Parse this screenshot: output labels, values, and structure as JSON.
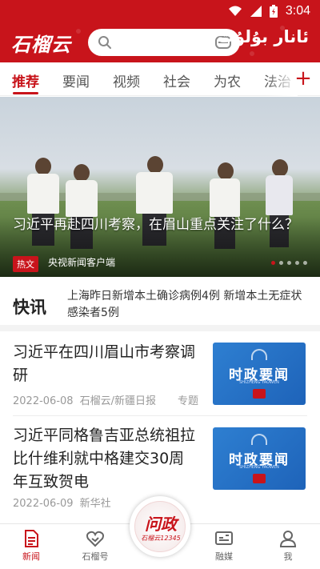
{
  "status_bar": {
    "time": "3:04",
    "icons": [
      "wifi-icon",
      "signal-icon",
      "battery-icon"
    ]
  },
  "header": {
    "logo_text": "石榴云",
    "uyghur_text": "ئانار بۇلۇت",
    "brand_color": "#c8141b"
  },
  "tabs": [
    {
      "label": "推荐",
      "active": true
    },
    {
      "label": "要闻"
    },
    {
      "label": "视频"
    },
    {
      "label": "社会"
    },
    {
      "label": "为农"
    },
    {
      "label": "法治"
    }
  ],
  "tab_add_label": "+",
  "hero": {
    "title": "习近平再赴四川考察，在眉山重点关注了什么？",
    "badge": "热文",
    "source": "央视新闻客户端",
    "slide_count": 5,
    "active_slide": 1
  },
  "flash": {
    "title": "快讯",
    "text": "上海昨日新增本土确诊病例4例 新增本土无症状感染者5例"
  },
  "news": [
    {
      "title": "习近平在四川眉山市考察调研",
      "date": "2022-06-08",
      "source": "石榴云/新疆日报",
      "tag": "专题",
      "thumb_text": "时政要闻",
      "thumb_sub": "SHIZHENG YAOWEN"
    },
    {
      "title": "习近平同格鲁吉亚总统祖拉比什维利就中格建交30周年互致贺电",
      "date": "2022-06-09",
      "source": "新华社",
      "tag": "",
      "thumb_text": "时政要闻",
      "thumb_sub": "SHIZHENG YAOWEN"
    }
  ],
  "bottom_nav": [
    {
      "label": "新闻",
      "icon": "news-icon",
      "active": true
    },
    {
      "label": "石榴号",
      "icon": "heart-icon"
    },
    {
      "label": "融媒",
      "icon": "tv-icon"
    },
    {
      "label": "我",
      "icon": "person-icon"
    }
  ],
  "center_button": {
    "label": "问政",
    "sub": "石榴云12345"
  }
}
